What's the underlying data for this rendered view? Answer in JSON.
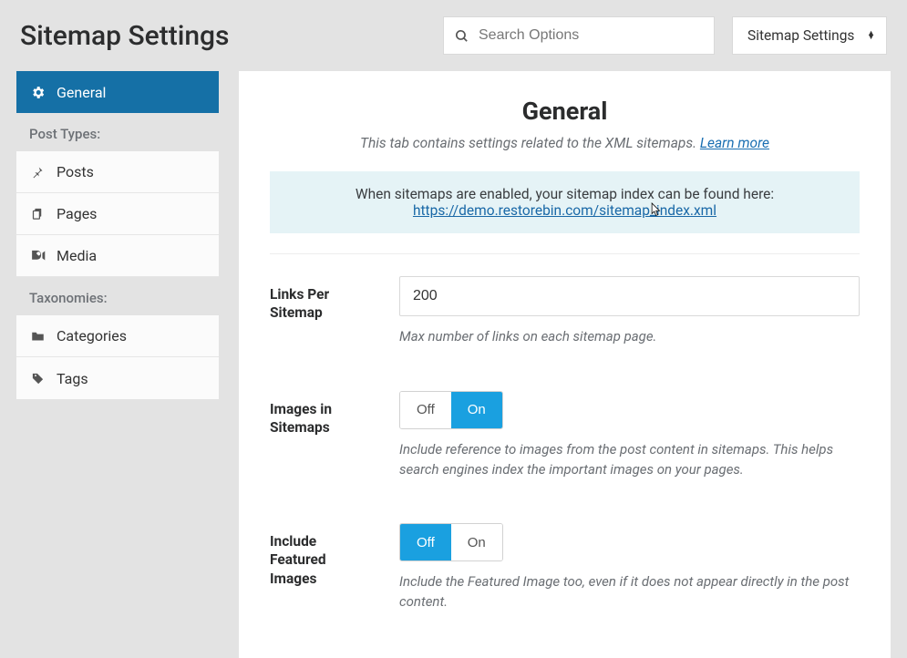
{
  "header": {
    "title": "Sitemap Settings",
    "search_placeholder": "Search Options",
    "breadcrumb_value": "Sitemap Settings"
  },
  "sidebar": {
    "items": [
      {
        "label": "General",
        "icon": "gear-icon",
        "active": true
      },
      {
        "heading": "Post Types:"
      },
      {
        "label": "Posts",
        "icon": "pin-icon"
      },
      {
        "label": "Pages",
        "icon": "copy-icon"
      },
      {
        "label": "Media",
        "icon": "media-icon"
      },
      {
        "heading": "Taxonomies:"
      },
      {
        "label": "Categories",
        "icon": "folder-icon"
      },
      {
        "label": "Tags",
        "icon": "tag-icon"
      }
    ]
  },
  "main": {
    "title": "General",
    "subtitle_prefix": "This tab contains settings related to the XML sitemaps. ",
    "subtitle_link": "Learn more",
    "notice_text": "When sitemaps are enabled, your sitemap index can be found here:",
    "notice_link": "https://demo.restorebin.com/sitemap_index.xml",
    "fields": {
      "links_per_sitemap": {
        "label": "Links Per Sitemap",
        "value": "200",
        "help": "Max number of links on each sitemap page."
      },
      "images_in_sitemaps": {
        "label": "Images in Sitemaps",
        "off": "Off",
        "on": "On",
        "value": "On",
        "help": "Include reference to images from the post content in sitemaps. This helps search engines index the important images on your pages."
      },
      "include_featured": {
        "label": "Include Featured Images",
        "off": "Off",
        "on": "On",
        "value": "Off",
        "help": "Include the Featured Image too, even if it does not appear directly in the post content."
      }
    }
  }
}
